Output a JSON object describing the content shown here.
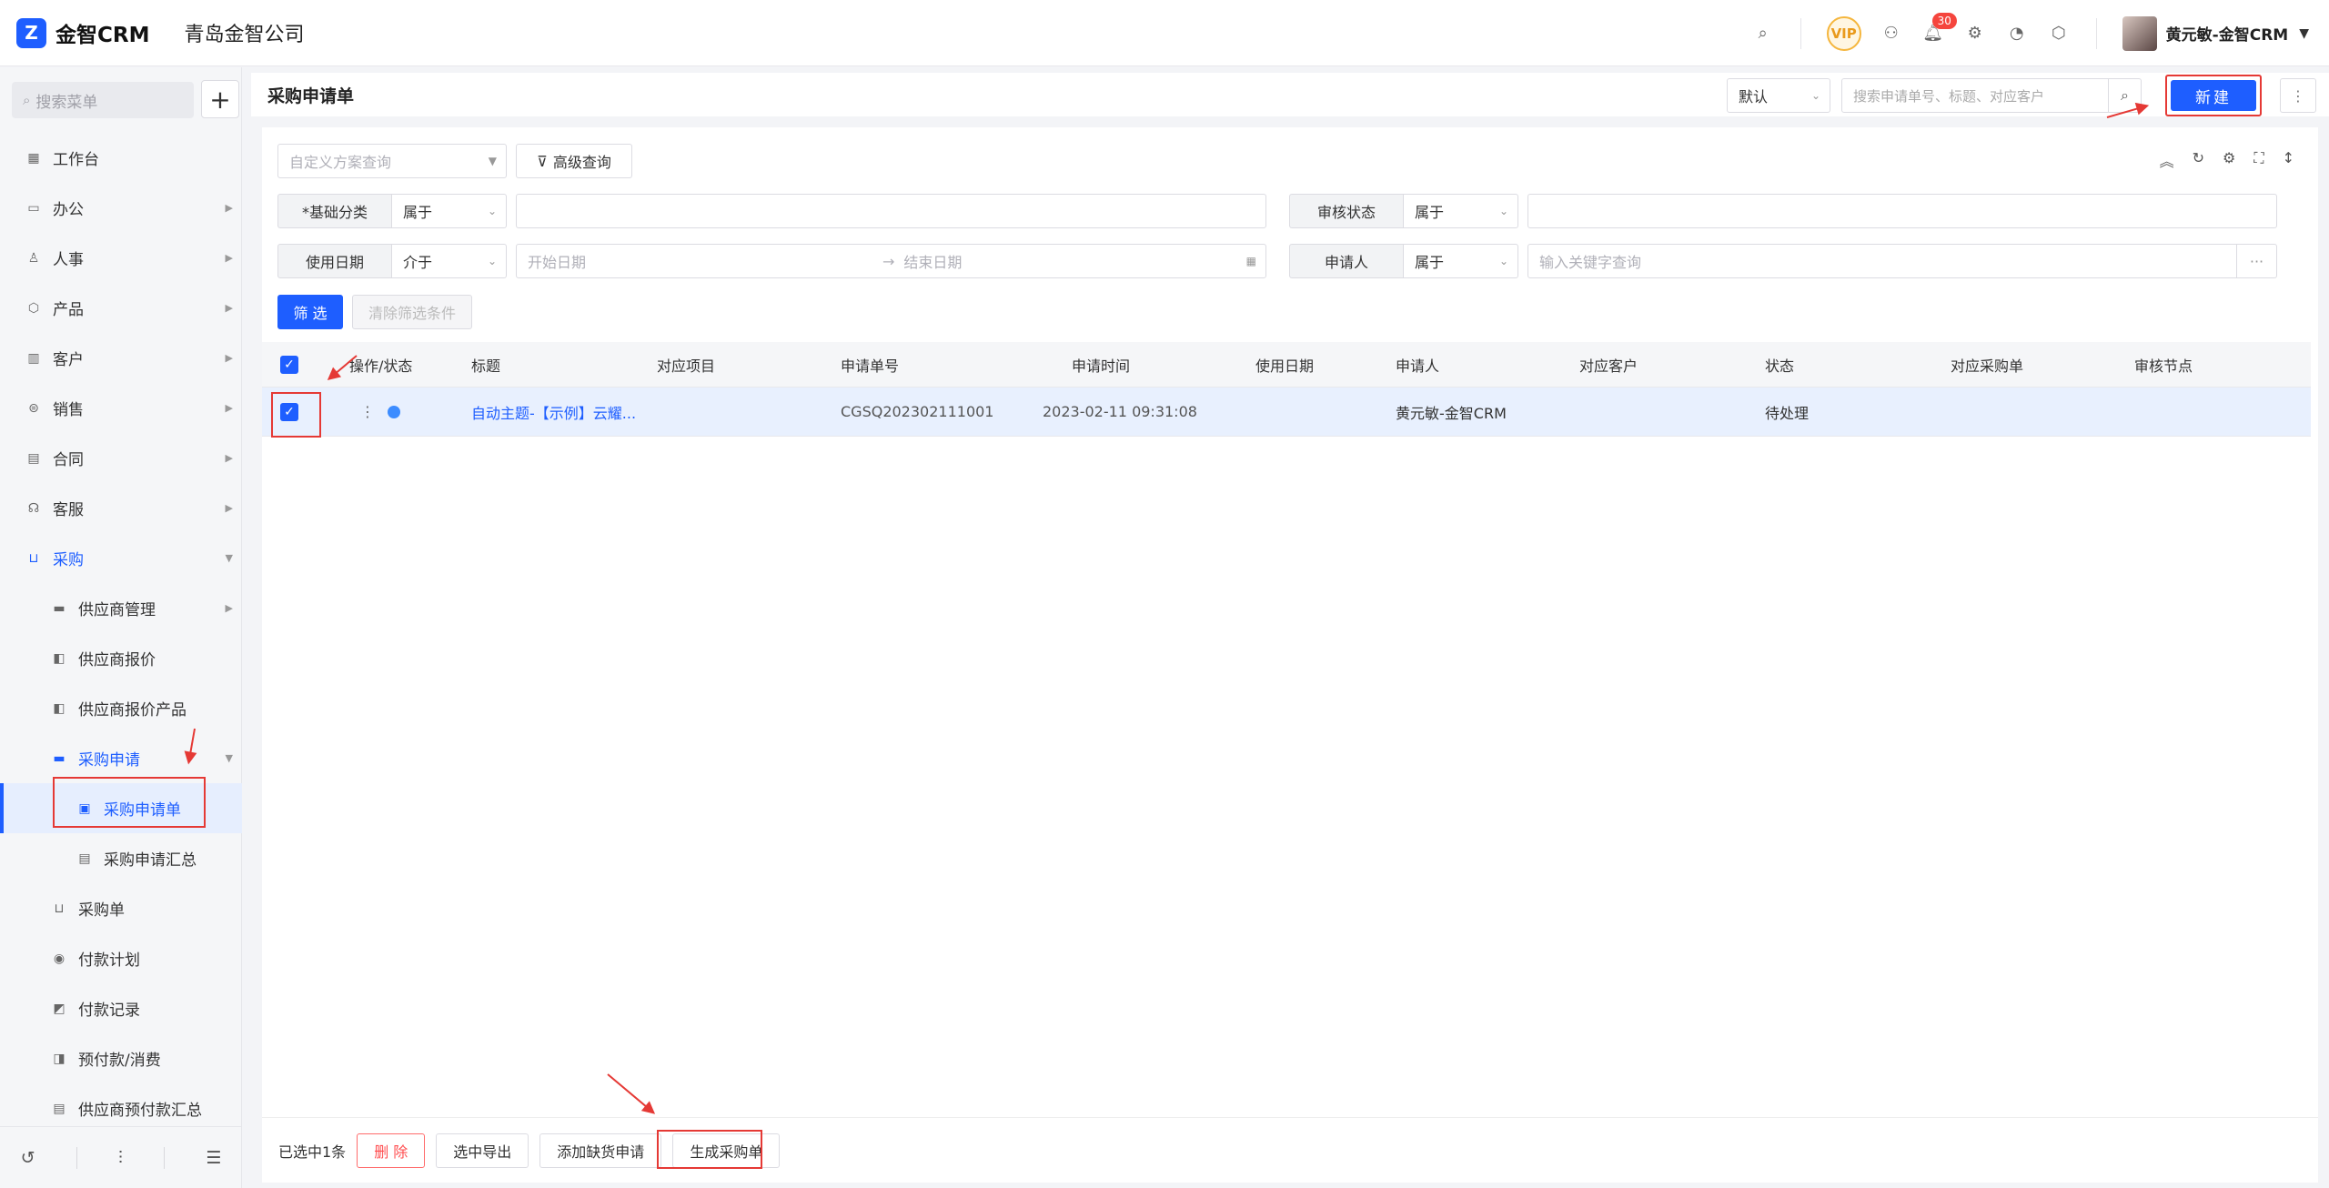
{
  "app": {
    "logo_mark": "Z",
    "name": "金智CRM",
    "company": "青岛金智公司"
  },
  "topbar": {
    "icons": [
      "search-icon",
      "vip-icon",
      "contact-icon",
      "bell-icon",
      "gear-icon",
      "pie-chart-icon",
      "cube-icon"
    ],
    "vip_label": "VIP",
    "notification_count": "30",
    "user_name": "黄元敏-金智CRM"
  },
  "sidebar": {
    "search_placeholder": "搜索菜单",
    "items": [
      {
        "label": "工作台"
      },
      {
        "label": "办公"
      },
      {
        "label": "人事"
      },
      {
        "label": "产品"
      },
      {
        "label": "客户"
      },
      {
        "label": "销售"
      },
      {
        "label": "合同"
      },
      {
        "label": "客服"
      },
      {
        "label": "采购"
      },
      {
        "label": "供应商管理"
      },
      {
        "label": "供应商报价"
      },
      {
        "label": "供应商报价产品"
      },
      {
        "label": "采购申请"
      },
      {
        "label": "采购申请单"
      },
      {
        "label": "采购申请汇总"
      },
      {
        "label": "采购单"
      },
      {
        "label": "付款计划"
      },
      {
        "label": "付款记录"
      },
      {
        "label": "预付款/消费"
      },
      {
        "label": "供应商预付款汇总"
      }
    ]
  },
  "header": {
    "title": "采购申请单",
    "view_select": "默认",
    "search_placeholder": "搜索申请单号、标题、对应客户",
    "new_button": "新建"
  },
  "filters": {
    "scheme_placeholder": "自定义方案查询",
    "advanced_button": "高级查询",
    "category_label": "*基础分类",
    "category_op": "属于",
    "audit_label": "审核状态",
    "audit_op": "属于",
    "date_label": "使用日期",
    "date_op": "介于",
    "start_placeholder": "开始日期",
    "end_placeholder": "结束日期",
    "applicant_label": "申请人",
    "applicant_op": "属于",
    "keyword_placeholder": "输入关键字查询",
    "filter_button": "筛 选",
    "clear_button": "清除筛选条件"
  },
  "table": {
    "columns": [
      "操作/状态",
      "标题",
      "对应项目",
      "申请单号",
      "申请时间",
      "使用日期",
      "申请人",
      "对应客户",
      "状态",
      "对应采购单",
      "审核节点"
    ],
    "rows": [
      {
        "title": "自动主题-【示例】云耀...",
        "project": "",
        "number": "CGSQ202302111001",
        "time": "2023-02-11 09:31:08",
        "use_date": "",
        "applicant": "黄元敏-金智CRM",
        "customer": "",
        "status": "待处理",
        "purchase_order": "",
        "audit_node": ""
      }
    ]
  },
  "footer": {
    "selected_text": "已选中1条",
    "delete_button": "删 除",
    "export_button": "选中导出",
    "add_shortage_button": "添加缺货申请",
    "generate_button": "生成采购单"
  },
  "colors": {
    "accent": "#1e5eff",
    "annotation": "#e53935"
  }
}
